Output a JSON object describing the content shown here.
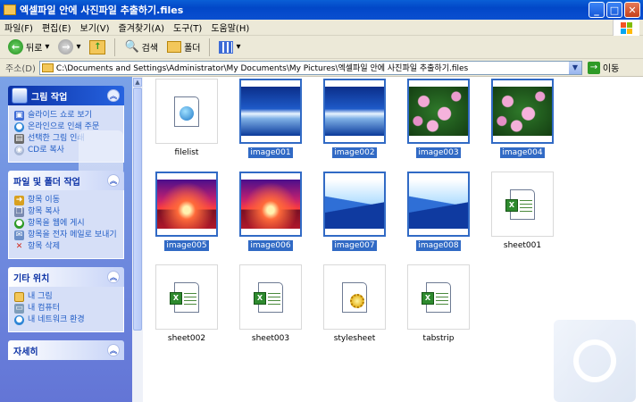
{
  "window": {
    "title": "엑셀파일 안에 사진파일 추출하기.files",
    "minimize": "_",
    "maximize": "□",
    "close": "✕"
  },
  "menu": [
    "파일(F)",
    "편집(E)",
    "보기(V)",
    "즐겨찾기(A)",
    "도구(T)",
    "도움말(H)"
  ],
  "toolbar": {
    "back": "뒤로",
    "search": "검색",
    "folders": "폴더"
  },
  "address": {
    "label": "주소(D)",
    "path": "C:\\Documents and Settings\\Administrator\\My Documents\\My Pictures\\엑셀파일 안에 사진파일 추출하기.files",
    "go": "이동"
  },
  "taskpane": {
    "picture_tasks": {
      "title": "그림 작업",
      "items": [
        "슬라이드 쇼로 보기",
        "온라인으로 인쇄 주문",
        "선택한 그림 인쇄",
        "CD로 복사"
      ]
    },
    "file_tasks": {
      "title": "파일 및 폴더 작업",
      "items": [
        "항목 이동",
        "항목 복사",
        "항목을 웹에 게시",
        "항목을 전자 메일로 보내기",
        "항목 삭제"
      ]
    },
    "other_places": {
      "title": "기타 위치",
      "items": [
        "내 그림",
        "내 컴퓨터",
        "내 네트워크 환경"
      ]
    },
    "details": {
      "title": "자세히"
    }
  },
  "files": [
    {
      "name": "filelist",
      "kind": "html",
      "selected": false
    },
    {
      "name": "image001",
      "kind": "wave",
      "selected": true
    },
    {
      "name": "image002",
      "kind": "wave",
      "selected": true
    },
    {
      "name": "image003",
      "kind": "lotus",
      "selected": true
    },
    {
      "name": "image004",
      "kind": "lotus",
      "selected": true
    },
    {
      "name": "image005",
      "kind": "sunset",
      "selected": true
    },
    {
      "name": "image006",
      "kind": "sunset",
      "selected": true
    },
    {
      "name": "image007",
      "kind": "mount",
      "selected": true
    },
    {
      "name": "image008",
      "kind": "mount",
      "selected": true
    },
    {
      "name": "sheet001",
      "kind": "excel",
      "selected": false
    },
    {
      "name": "sheet002",
      "kind": "excel",
      "selected": false
    },
    {
      "name": "sheet003",
      "kind": "excel",
      "selected": false
    },
    {
      "name": "stylesheet",
      "kind": "css",
      "selected": false
    },
    {
      "name": "tabstrip",
      "kind": "excel",
      "selected": false
    }
  ]
}
